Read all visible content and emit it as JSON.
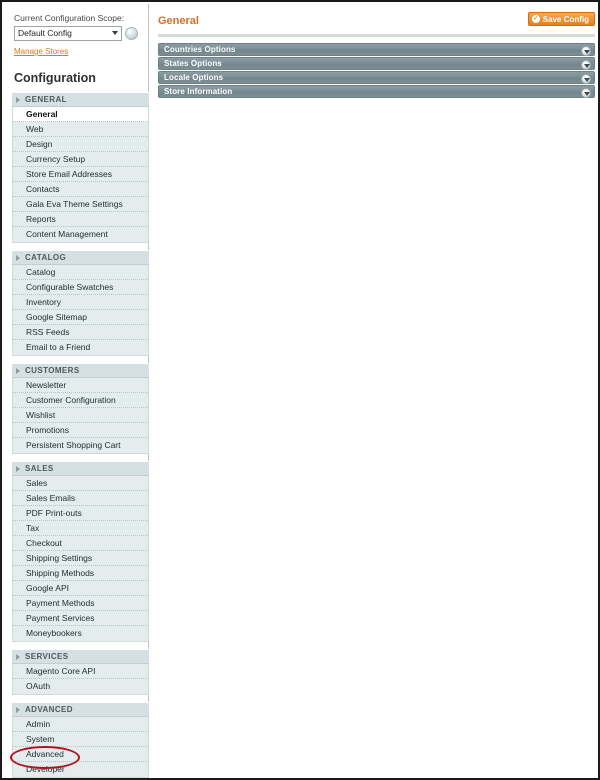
{
  "scope": {
    "label": "Current Configuration Scope:",
    "selected": "Default Config",
    "help_icon": "help-globe-icon",
    "manage_stores_link": "Manage Stores"
  },
  "sidebar": {
    "title": "Configuration",
    "sections": [
      {
        "header": "GENERAL",
        "items": [
          {
            "label": "General",
            "active": true
          },
          {
            "label": "Web",
            "active": false
          },
          {
            "label": "Design",
            "active": false
          },
          {
            "label": "Currency Setup",
            "active": false
          },
          {
            "label": "Store Email Addresses",
            "active": false
          },
          {
            "label": "Contacts",
            "active": false
          },
          {
            "label": "Gala Eva Theme Settings",
            "active": false
          },
          {
            "label": "Reports",
            "active": false
          },
          {
            "label": "Content Management",
            "active": false
          }
        ]
      },
      {
        "header": "CATALOG",
        "items": [
          {
            "label": "Catalog",
            "active": false
          },
          {
            "label": "Configurable Swatches",
            "active": false
          },
          {
            "label": "Inventory",
            "active": false
          },
          {
            "label": "Google Sitemap",
            "active": false
          },
          {
            "label": "RSS Feeds",
            "active": false
          },
          {
            "label": "Email to a Friend",
            "active": false
          }
        ]
      },
      {
        "header": "CUSTOMERS",
        "items": [
          {
            "label": "Newsletter",
            "active": false
          },
          {
            "label": "Customer Configuration",
            "active": false
          },
          {
            "label": "Wishlist",
            "active": false
          },
          {
            "label": "Promotions",
            "active": false
          },
          {
            "label": "Persistent Shopping Cart",
            "active": false
          }
        ]
      },
      {
        "header": "SALES",
        "items": [
          {
            "label": "Sales",
            "active": false
          },
          {
            "label": "Sales Emails",
            "active": false
          },
          {
            "label": "PDF Print-outs",
            "active": false
          },
          {
            "label": "Tax",
            "active": false
          },
          {
            "label": "Checkout",
            "active": false
          },
          {
            "label": "Shipping Settings",
            "active": false
          },
          {
            "label": "Shipping Methods",
            "active": false
          },
          {
            "label": "Google API",
            "active": false
          },
          {
            "label": "Payment Methods",
            "active": false
          },
          {
            "label": "Payment Services",
            "active": false
          },
          {
            "label": "Moneybookers",
            "active": false
          }
        ]
      },
      {
        "header": "SERVICES",
        "items": [
          {
            "label": "Magento Core API",
            "active": false
          },
          {
            "label": "OAuth",
            "active": false
          }
        ]
      },
      {
        "header": "ADVANCED",
        "items": [
          {
            "label": "Admin",
            "active": false
          },
          {
            "label": "System",
            "active": false
          },
          {
            "label": "Advanced",
            "active": false
          },
          {
            "label": "Developer",
            "active": false
          }
        ]
      }
    ]
  },
  "main": {
    "page_title": "General",
    "save_button": {
      "label": "Save Config",
      "icon": "check-circle-icon",
      "color": "#e8801f"
    },
    "sections": [
      {
        "label": "Countries Options",
        "icon": "chevron-down-icon"
      },
      {
        "label": "States Options",
        "icon": "chevron-down-icon"
      },
      {
        "label": "Locale Options",
        "icon": "chevron-down-icon"
      },
      {
        "label": "Store Information",
        "icon": "chevron-down-icon"
      }
    ]
  },
  "annotation": {
    "highlight_target": "Advanced",
    "color": "#b4121b",
    "shape": "ellipse"
  },
  "colors": {
    "accent_orange": "#d4702a",
    "section_bar": "#7c8e96",
    "sidebar_section_header": "#d5e0e2",
    "sidebar_items_bg": "#e4ecee"
  }
}
